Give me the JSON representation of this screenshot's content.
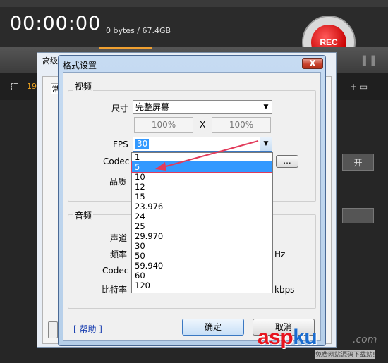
{
  "app": {
    "timer": "00:00:00",
    "size_readout": "0 bytes / 67.4GB",
    "rec_label": "REC",
    "left_tab_label": "19.",
    "right_button_label": "开"
  },
  "back_dialog": {
    "title": "高级",
    "inner_label": "常"
  },
  "dialog": {
    "title": "格式设置",
    "close_label": "X",
    "video": {
      "group_label": "视频",
      "size_label": "尺寸",
      "size_value": "完整屏幕",
      "width_value": "100%",
      "x_label": "X",
      "height_value": "100%",
      "fps_label": "FPS",
      "fps_value": "30",
      "codec_label": "Codec",
      "codec_more_label": "...",
      "quality_label": "品质"
    },
    "audio": {
      "group_label": "音频",
      "channel_label": "声道",
      "frequency_label": "频率",
      "frequency_unit": "Hz",
      "codec_label": "Codec",
      "bitrate_label": "比特率",
      "bitrate_unit": "kbps"
    },
    "help_link": "[ 帮助 ]",
    "ok_label": "确定",
    "cancel_label": "取消"
  },
  "fps_dropdown": {
    "selected_index": 1,
    "options": [
      "1",
      "5",
      "10",
      "12",
      "15",
      "23.976",
      "24",
      "25",
      "29.970",
      "30",
      "50",
      "59.940",
      "60",
      "120"
    ]
  },
  "watermark": {
    "logo_part1": "asp",
    "logo_part2": "ku",
    "domain_suffix": ".com",
    "subtitle": "免费网站源码下载站!"
  },
  "colors": {
    "accent_selection": "#3399ff",
    "annotation_red": "#e23a5a",
    "rec_red": "#c80000"
  }
}
